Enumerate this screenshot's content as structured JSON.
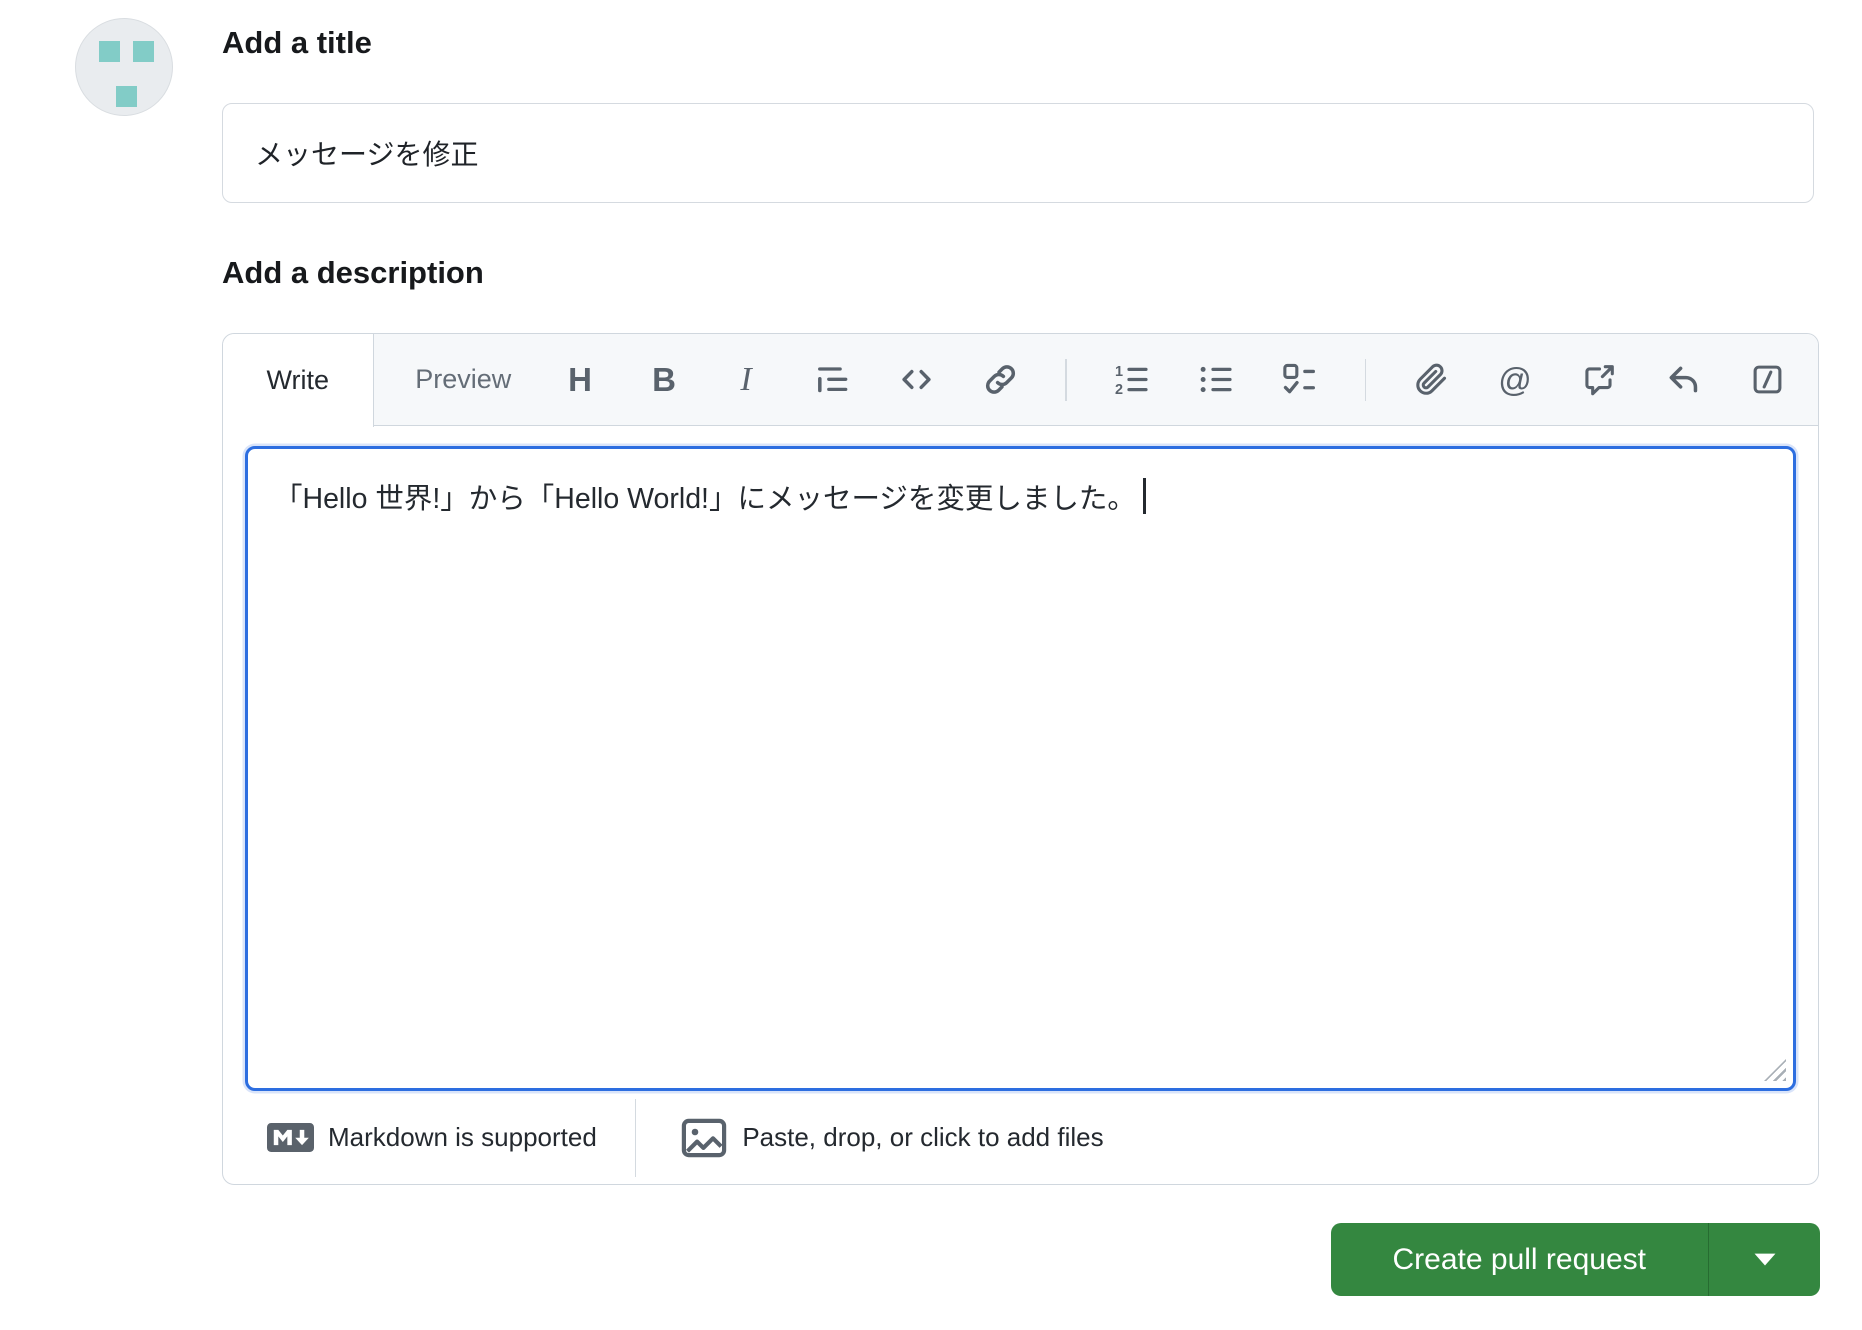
{
  "form": {
    "title_label": "Add a title",
    "title_value": "メッセージを修正",
    "description_label": "Add a description"
  },
  "editor": {
    "tabs": [
      {
        "label": "Write",
        "active": true
      },
      {
        "label": "Preview",
        "active": false
      }
    ],
    "toolbar_icons": [
      "heading-icon",
      "bold-icon",
      "italic-icon",
      "quote-icon",
      "code-icon",
      "link-icon",
      "numbered-list-icon",
      "unordered-list-icon",
      "task-list-icon",
      "attach-file-icon",
      "mention-icon",
      "cross-reference-icon",
      "reply-icon",
      "slash-commands-icon"
    ],
    "icon_glyphs": {
      "heading": "H",
      "bold": "B",
      "italic": "I",
      "mention": "@"
    },
    "body_text": "「Hello 世界!」から「Hello World!」にメッセージを変更しました。",
    "footer": {
      "markdown_note": "Markdown is supported",
      "paste_note": "Paste, drop, or click to add files"
    }
  },
  "actions": {
    "create_label": "Create pull request"
  },
  "colors": {
    "button_green": "#348740",
    "focus_blue": "#2d6ee0",
    "avatar_teal": "#82ccc7",
    "icon_gray": "#59626c",
    "border_gray": "#d0d7de",
    "toolbar_bg": "#f6f8fa"
  }
}
